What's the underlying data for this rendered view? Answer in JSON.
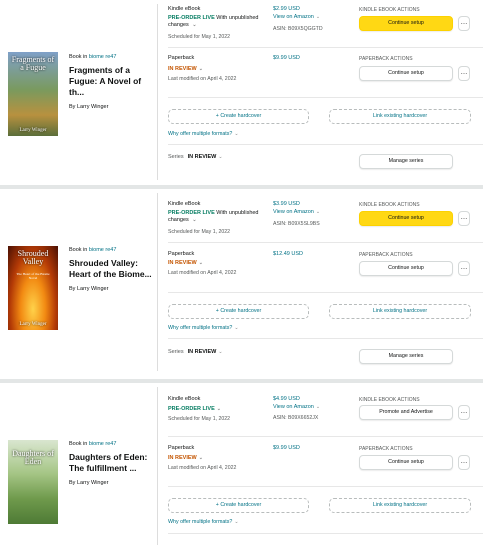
{
  "books": [
    {
      "cover": {
        "title": "Fragments of a Fugue",
        "author": "Larry Winger",
        "colors": [
          "#6f8b58",
          "#c8a45a"
        ]
      },
      "book_in_prefix": "Book in",
      "book_in_link": "biome re47",
      "title": "Fragments of a Fugue: A Novel of th...",
      "author": "By Larry Winger",
      "ebook": {
        "format": "Kindle eBook",
        "status": "PRE-ORDER LIVE",
        "status_extra": "With unpublished changes",
        "scheduled": "Scheduled for May 1, 2022",
        "price": "$2.99 USD",
        "view_link": "View on Amazon",
        "asin": "ASIN: B09X5QGGTD",
        "actions_label": "KINDLE EBOOK ACTIONS",
        "button": "Continue setup",
        "button_style": "yellow"
      },
      "paperback": {
        "format": "Paperback",
        "status": "IN REVIEW",
        "modified": "Last modified on April 4, 2022",
        "price": "$9.99 USD",
        "actions_label": "PAPERBACK ACTIONS",
        "button": "Continue setup"
      },
      "create_hardcover": "+ Create hardcover",
      "link_hardcover": "Link existing hardcover",
      "why_multiple": "Why offer multiple formats?",
      "series_label": "Series",
      "series_status": "IN REVIEW",
      "manage_series": "Manage series"
    },
    {
      "cover": {
        "title": "Shrouded Valley",
        "subtitle": "The Heart of the Biome Novel",
        "author": "Larry Winger",
        "colors": [
          "#8a1e05",
          "#f08a12"
        ]
      },
      "book_in_prefix": "Book in",
      "book_in_link": "biome re47",
      "title": "Shrouded Valley: Heart of the Biome...",
      "author": "By Larry Winger",
      "ebook": {
        "format": "Kindle eBook",
        "status": "PRE-ORDER LIVE",
        "status_extra": "With unpublished changes",
        "scheduled": "Scheduled for May 1, 2022",
        "price": "$3.99 USD",
        "view_link": "View on Amazon",
        "asin": "ASIN: B09X5SL9BS",
        "actions_label": "KINDLE EBOOK ACTIONS",
        "button": "Continue setup",
        "button_style": "yellow"
      },
      "paperback": {
        "format": "Paperback",
        "status": "IN REVIEW",
        "modified": "Last modified on April 4, 2022",
        "price": "$12.49 USD",
        "actions_label": "PAPERBACK ACTIONS",
        "button": "Continue setup"
      },
      "create_hardcover": "+ Create hardcover",
      "link_hardcover": "Link existing hardcover",
      "why_multiple": "Why offer multiple formats?",
      "series_label": "Series",
      "series_status": "IN REVIEW",
      "manage_series": "Manage series"
    },
    {
      "cover": {
        "title": "Daughters of Eden",
        "author": "",
        "colors": [
          "#9fbf7a",
          "#5f8a3f"
        ]
      },
      "book_in_prefix": "Book in",
      "book_in_link": "biome re47",
      "title": "Daughters of Eden: The fulfillment ...",
      "author": "By Larry Winger",
      "ebook": {
        "format": "Kindle eBook",
        "status": "PRE-ORDER LIVE",
        "status_extra": "",
        "scheduled": "Scheduled for May 1, 2022",
        "price": "$4.99 USD",
        "view_link": "View on Amazon",
        "asin": "ASIN: B09X6652JX",
        "actions_label": "KINDLE EBOOK ACTIONS",
        "button": "Promote and Advertise",
        "button_style": "white"
      },
      "paperback": {
        "format": "Paperback",
        "status": "IN REVIEW",
        "modified": "Last modified on April 4, 2022",
        "price": "$9.99 USD",
        "actions_label": "PAPERBACK ACTIONS",
        "button": "Continue setup"
      },
      "create_hardcover": "+ Create hardcover",
      "link_hardcover": "Link existing hardcover",
      "why_multiple": "Why offer multiple formats?"
    }
  ],
  "icons": {
    "more": "ellipsis-icon",
    "caret": "chevron-down-icon"
  }
}
